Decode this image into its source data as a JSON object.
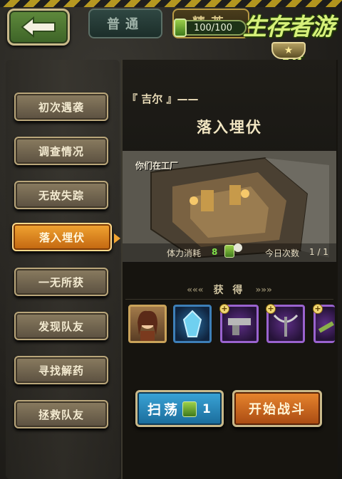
{
  "header": {
    "tab_normal": "普通",
    "tab_hard": "精英",
    "stamina": "100/100",
    "logo_text": "生存者游戏"
  },
  "sidebar": {
    "items": [
      {
        "label": "初次遇袭",
        "active": false
      },
      {
        "label": "调查情况",
        "active": false
      },
      {
        "label": "无故失踪",
        "active": false
      },
      {
        "label": "落入埋伏",
        "active": true
      },
      {
        "label": "一无所获",
        "active": false
      },
      {
        "label": "发现队友",
        "active": false
      },
      {
        "label": "寻找解药",
        "active": false
      },
      {
        "label": "拯救队友",
        "active": false
      }
    ]
  },
  "stage": {
    "character": "『 吉尔 』——",
    "title": "落入埋伏",
    "dialog": "你们在工厂",
    "stamina_cost_label": "体力消耗",
    "stamina_cost_value": "8",
    "daily_label": "今日次数",
    "daily_value": "1 / 1"
  },
  "rewards": {
    "title": "获 得",
    "left_deco": "«««",
    "right_deco": "»»»",
    "items": [
      {
        "icon": "character-portrait-icon",
        "rarity": "gold"
      },
      {
        "icon": "blue-crystal-icon",
        "rarity": "blue"
      },
      {
        "icon": "pistol-icon",
        "rarity": "purple"
      },
      {
        "icon": "crossbow-icon",
        "rarity": "purple"
      },
      {
        "icon": "rifle-icon",
        "rarity": "purple"
      }
    ]
  },
  "actions": {
    "sweep_label": "扫荡",
    "sweep_count": "1",
    "battle_label": "开始战斗"
  },
  "colors": {
    "active_menu": "#f2a532",
    "menu": "#8a7c60",
    "sweep_button": "#3aa5d8",
    "battle_button": "#e9862e",
    "stamina_green": "#7fe24a"
  }
}
